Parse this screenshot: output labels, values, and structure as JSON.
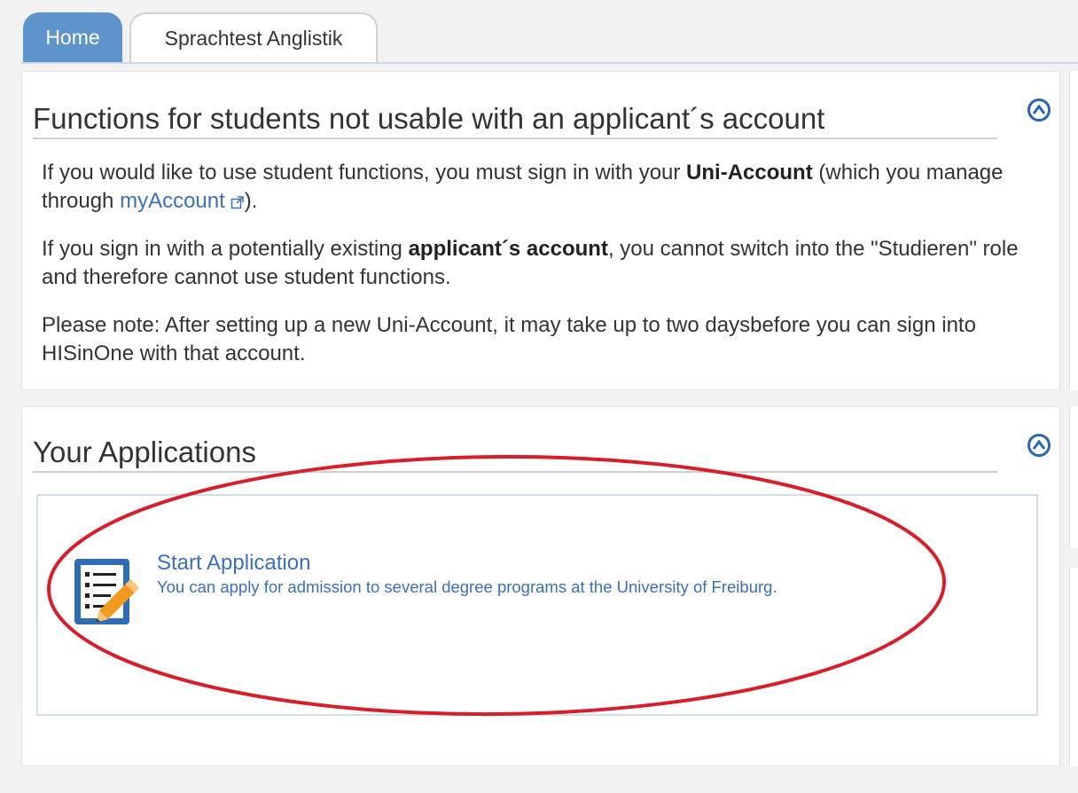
{
  "tabs": [
    {
      "label": "Home",
      "active": true
    },
    {
      "label": "Sprachtest Anglistik",
      "active": false
    }
  ],
  "notice_panel": {
    "title": "Functions for students not usable with an applicant´s account",
    "p1_a": "If you would like to use student functions, you must sign in with your ",
    "p1_bold": "Uni-Account",
    "p1_b": " (which you manage through ",
    "p1_link": "myAccount",
    "p1_c": ").",
    "p2_a": "If you sign in with a potentially existing ",
    "p2_bold": "applicant´s account",
    "p2_b": ", you cannot switch into the \"Studieren\" role and therefore cannot use student functions.",
    "p3": "Please note: After setting up a new Uni-Account, it may take up to two daysbefore you can sign into HISinOne with that account."
  },
  "applications_panel": {
    "title": "Your Applications",
    "start_label": "Start Application",
    "start_description": "You can apply for admission to several degree programs at the University of Freiburg."
  },
  "icons": {
    "collapse": "chevron-up-circle-icon",
    "external_link": "external-link-icon",
    "application": "clipboard-pencil-icon"
  },
  "colors": {
    "accent": "#5f93cc",
    "link": "#3a70b8",
    "highlight_ellipse": "#d61f2b"
  }
}
